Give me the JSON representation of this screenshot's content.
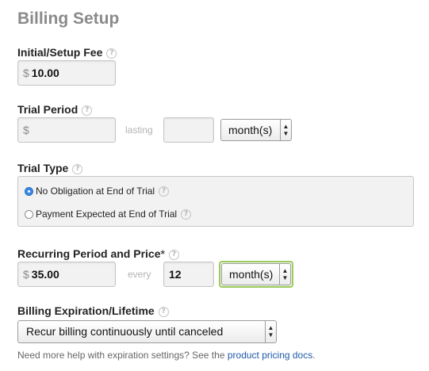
{
  "page": {
    "title": "Billing Setup"
  },
  "icons": {
    "help": "question-circle-icon",
    "dropdown": "dropdown-arrows-icon",
    "radio": "radio-icon"
  },
  "colors": {
    "focus_border": "#9ccb5d",
    "radio_checked": "#3b8ae6",
    "link": "#1f5aa8",
    "title": "#8a8a8a"
  },
  "setup_fee": {
    "label": "Initial/Setup Fee",
    "currency": "$",
    "value": "10.00"
  },
  "trial_period": {
    "label": "Trial Period",
    "currency": "$",
    "price_value": "",
    "lasting_label": "lasting",
    "length_value": "",
    "unit_selected": "month(s)"
  },
  "trial_type": {
    "label": "Trial Type",
    "options": [
      {
        "label": "No Obligation at End of Trial",
        "checked": true
      },
      {
        "label": "Payment Expected at End of Trial",
        "checked": false
      }
    ]
  },
  "recurring": {
    "label": "Recurring Period and Price",
    "required_mark": "*",
    "currency": "$",
    "price_value": "35.00",
    "every_label": "every",
    "interval_value": "12",
    "unit_selected": "month(s)"
  },
  "expiration": {
    "label": "Billing Expiration/Lifetime",
    "selected": "Recur billing continuously until canceled",
    "help_text": "Need more help with expiration settings? See the",
    "link_text": "product pricing docs",
    "help_suffix": "."
  }
}
